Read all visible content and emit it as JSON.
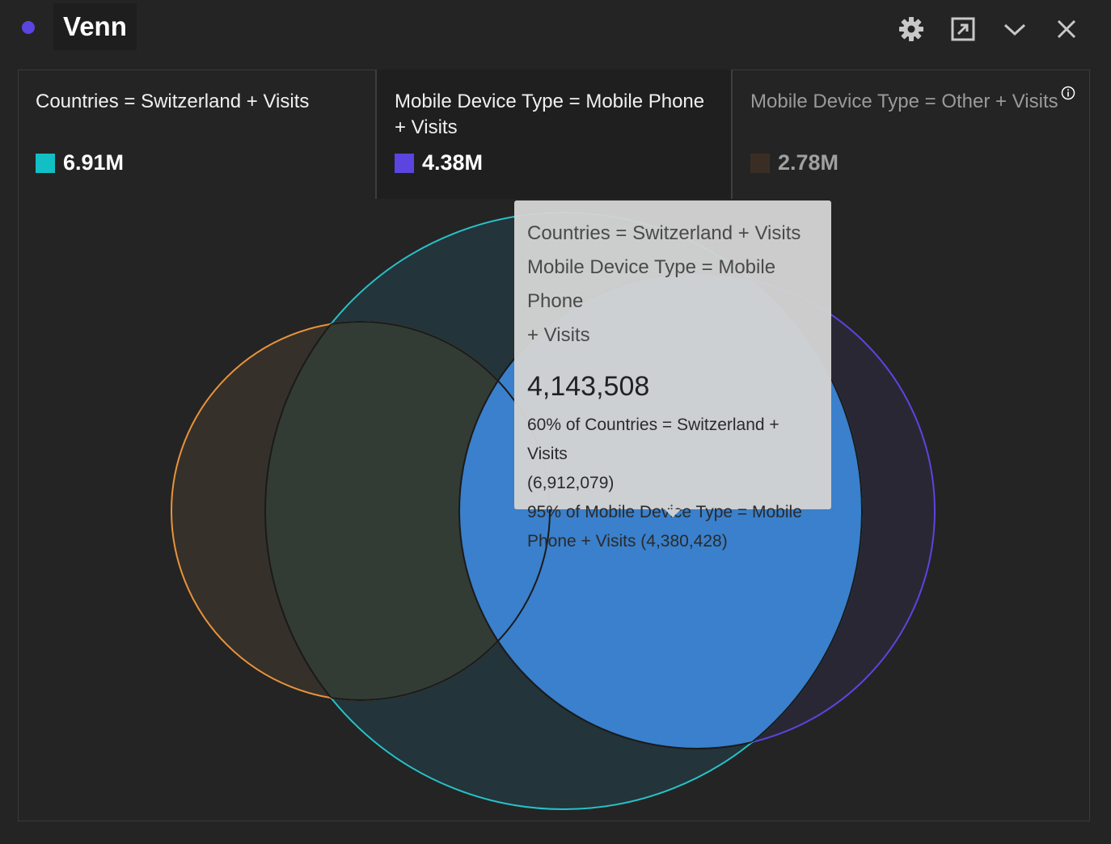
{
  "header": {
    "title": "Venn",
    "icons": [
      "gear-icon",
      "popout-icon",
      "chevron-down-icon",
      "close-icon"
    ]
  },
  "legend": [
    {
      "label": "Countries = Switzerland + Visits",
      "value": "6.91M",
      "color": "#12bfc4"
    },
    {
      "label": "Mobile Device Type = Mobile Phone + Visits",
      "value": "4.38M",
      "color": "#5a45e0"
    },
    {
      "label": "Mobile Device Type = Other + Visits",
      "value": "2.78M",
      "color": "#3a2e24"
    }
  ],
  "colors": {
    "switzerland_stroke": "#26c2c8",
    "mobile_phone_stroke": "#5a45e0",
    "other_stroke": "#e8933a",
    "highlight_fill": "#3a80cc"
  },
  "tooltip": {
    "segment_1": "Countries = Switzerland + Visits",
    "segment_2": "Mobile Device Type = Mobile Phone",
    "segment_2b": "+ Visits",
    "value": "4,143,508",
    "pct_1a": "60% of Countries = Switzerland + Visits",
    "pct_1b": "(6,912,079)",
    "pct_2a": "95% of Mobile Device Type = Mobile",
    "pct_2b": "Phone + Visits (4,380,428)"
  }
}
